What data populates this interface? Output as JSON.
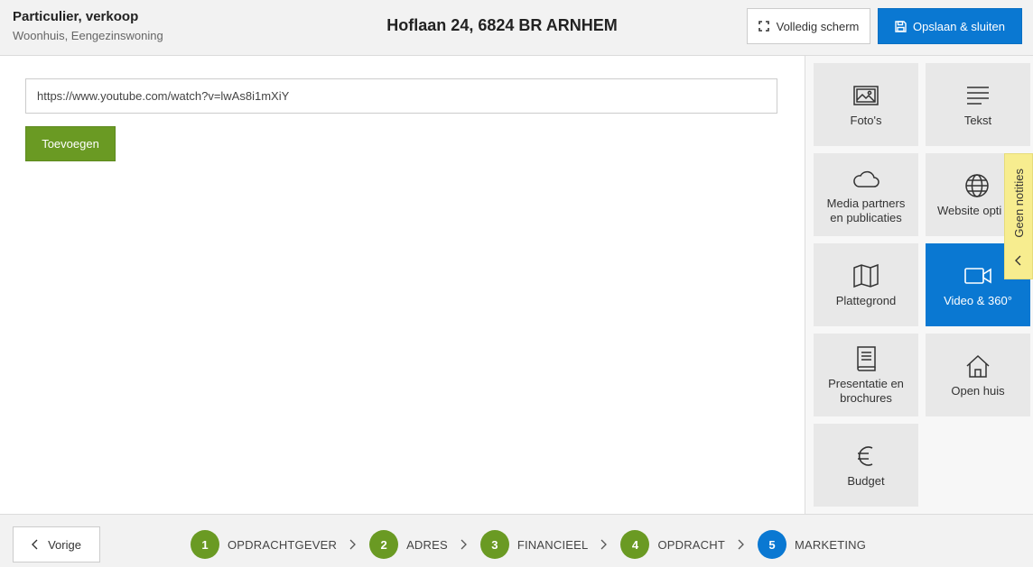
{
  "header": {
    "title": "Particulier, verkoop",
    "subtitle": "Woonhuis, Eengezinswoning",
    "address": "Hoflaan 24, 6824 BR ARNHEM",
    "fullscreen_label": "Volledig scherm",
    "save_label": "Opslaan & sluiten"
  },
  "main": {
    "url_value": "https://www.youtube.com/watch?v=lwAs8i1mXiY",
    "add_label": "Toevoegen"
  },
  "sidebar": {
    "tiles": [
      {
        "line1": "Foto's",
        "line2": "",
        "icon": "image-icon"
      },
      {
        "line1": "Tekst",
        "line2": "",
        "icon": "text-lines-icon"
      },
      {
        "line1": "Media partners",
        "line2": "en publicaties",
        "icon": "cloud-icon"
      },
      {
        "line1": "Website opti",
        "line2": "",
        "icon": "globe-icon"
      },
      {
        "line1": "Plattegrond",
        "line2": "",
        "icon": "map-icon"
      },
      {
        "line1": "Video & 360°",
        "line2": "",
        "icon": "video-camera-icon",
        "active": true
      },
      {
        "line1": "Presentatie en",
        "line2": "brochures",
        "icon": "book-icon"
      },
      {
        "line1": "Open huis",
        "line2": "",
        "icon": "house-icon"
      },
      {
        "line1": "Budget",
        "line2": "",
        "icon": "euro-icon"
      }
    ],
    "notes_label": "Geen notities"
  },
  "footer": {
    "prev_label": "Vorige",
    "steps": [
      {
        "num": "1",
        "label": "OPDRACHTGEVER"
      },
      {
        "num": "2",
        "label": "ADRES"
      },
      {
        "num": "3",
        "label": "FINANCIEEL"
      },
      {
        "num": "4",
        "label": "OPDRACHT"
      },
      {
        "num": "5",
        "label": "MARKETING",
        "current": true
      }
    ]
  },
  "colors": {
    "primary_blue": "#0a78d2",
    "green": "#6a9a23",
    "notes_yellow": "#f7ed8f"
  }
}
